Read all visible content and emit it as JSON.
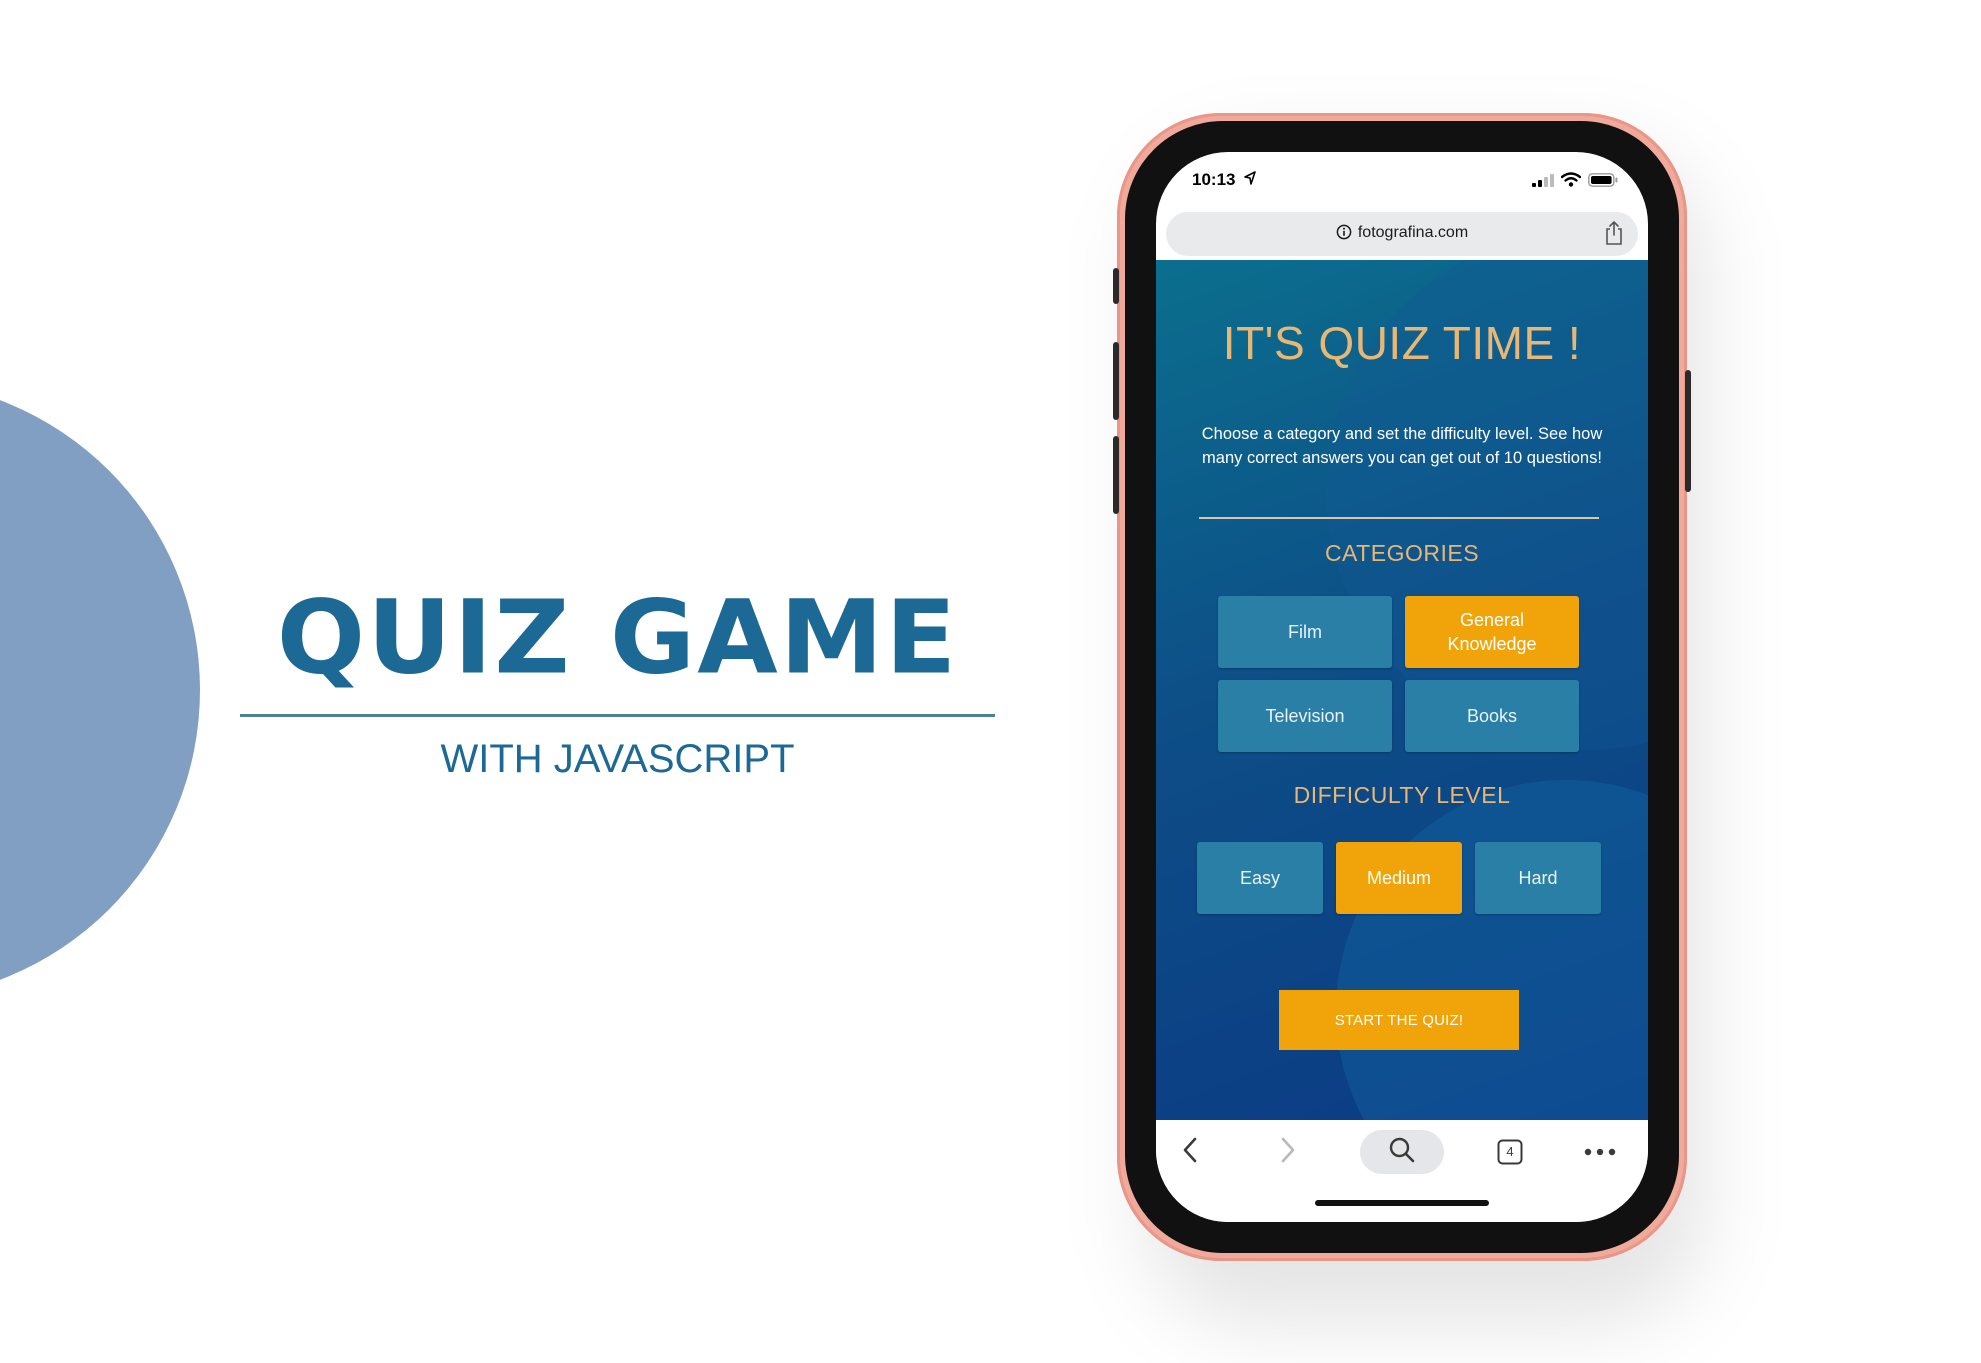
{
  "hero": {
    "title": "QUIZ GAME",
    "subtitle": "WITH JAVASCRIPT"
  },
  "status_bar": {
    "time": "10:13"
  },
  "browser": {
    "url": "fotografina.com",
    "tab_count": "4"
  },
  "quiz": {
    "title": "IT'S QUIZ TIME !",
    "intro": "Choose a category and set the difficulty level. See how many correct answers you can get out of 10 questions!",
    "categories_heading": "CATEGORIES",
    "categories": [
      {
        "label": "Film",
        "selected": false
      },
      {
        "label": "General Knowledge",
        "selected": true
      },
      {
        "label": "Television",
        "selected": false
      },
      {
        "label": "Books",
        "selected": false
      }
    ],
    "difficulty_heading": "DIFFICULTY LEVEL",
    "difficulty": [
      {
        "label": "Easy",
        "selected": false
      },
      {
        "label": "Medium",
        "selected": true
      },
      {
        "label": "Hard",
        "selected": false
      }
    ],
    "start_label": "START THE QUIZ!"
  },
  "colors": {
    "accent_orange": "#f1a40a",
    "heading_gold": "#e8b774",
    "option_blue": "#2a7fa6",
    "brand_blue": "#1c6995",
    "phone_case": "#f1a99c",
    "deco_circle": "#819ec3"
  },
  "icons": [
    "location-arrow-icon",
    "signal-icon",
    "wifi-icon",
    "battery-icon",
    "info-icon",
    "share-icon",
    "back-icon",
    "forward-icon",
    "search-icon",
    "tabs-icon",
    "more-icon"
  ]
}
